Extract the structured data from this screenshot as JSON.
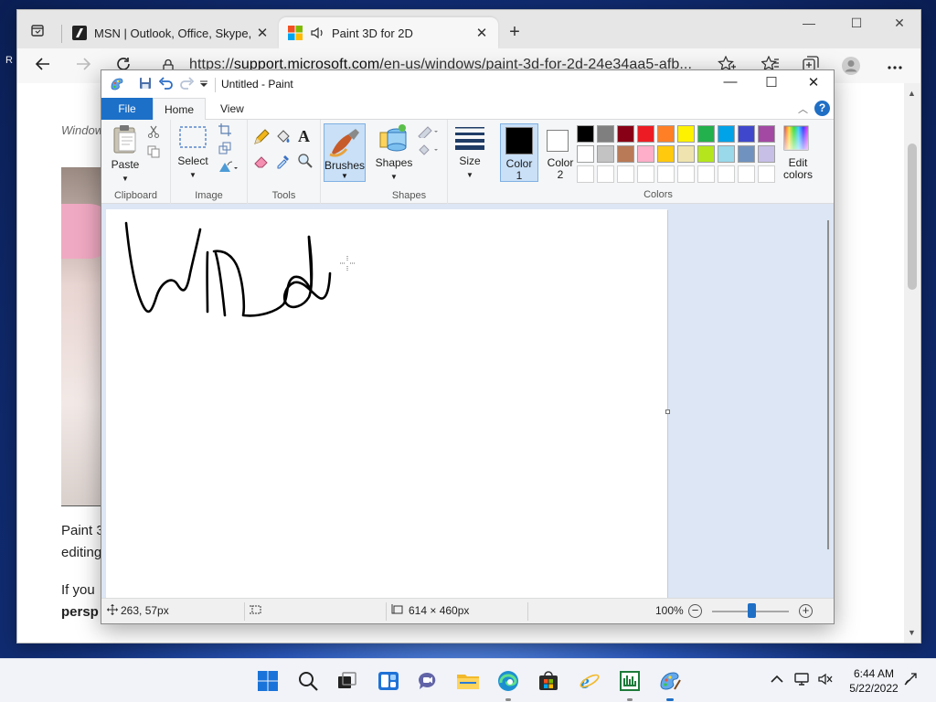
{
  "desktop": {
    "left_fragment": "R"
  },
  "browser": {
    "tabs": [
      {
        "title": "MSN | Outlook, Office, Skype, Bi",
        "close": "✕",
        "icon": "msn-icon"
      },
      {
        "title": "Paint 3D for 2D",
        "close": "✕",
        "icon": "microsoft-logo-icon",
        "audio_icon": "speaker-icon"
      }
    ],
    "new_tab": "+",
    "window_controls": {
      "minimize": "—",
      "maximize": "☐",
      "close": "✕"
    },
    "address": {
      "scheme": "https://",
      "host": "support.microsoft.com",
      "path": "/en-us/windows/paint-3d-for-2d-24e34aa5-afb..."
    },
    "page": {
      "crumb": "Window",
      "para1_line1": "Paint 3",
      "para1_line2": "editing",
      "para2_line1": "If you",
      "para2_line2_bold": "persp"
    }
  },
  "paint": {
    "window_title": "Untitled - Paint",
    "controls": {
      "minimize": "—",
      "maximize": "☐",
      "close": "✕"
    },
    "tabs": {
      "file": "File",
      "home": "Home",
      "view": "View"
    },
    "ribbon": {
      "clipboard": {
        "paste": "Paste",
        "label": "Clipboard"
      },
      "image": {
        "select": "Select",
        "label": "Image"
      },
      "tools": {
        "label": "Tools"
      },
      "brushes": {
        "label": "Brushes"
      },
      "shapes": {
        "shapes": "Shapes",
        "label": "Shapes"
      },
      "size": {
        "label": "Size"
      },
      "colors": {
        "color1": "Color",
        "color1_num": "1",
        "color2": "Color",
        "color2_num": "2",
        "edit": "Edit",
        "edit2": "colors",
        "label": "Colors",
        "color1_value": "#000000",
        "color2_value": "#ffffff",
        "palette_row1": [
          "#000000",
          "#7f7f7f",
          "#880015",
          "#ed1c24",
          "#ff7f27",
          "#fff200",
          "#22b14c",
          "#00a2e8",
          "#3f48cc",
          "#a349a4"
        ],
        "palette_row2": [
          "#ffffff",
          "#c3c3c3",
          "#b97a57",
          "#ffaec9",
          "#ffc90e",
          "#efe4b0",
          "#b5e61d",
          "#99d9ea",
          "#7092be",
          "#c8bfe7"
        ],
        "palette_row3": [
          "#ffffff",
          "#ffffff",
          "#ffffff",
          "#ffffff",
          "#ffffff",
          "#ffffff",
          "#ffffff",
          "#ffffff",
          "#ffffff",
          "#ffffff"
        ]
      }
    },
    "status": {
      "cursor_pos": "263, 57px",
      "canvas_size": "614 × 460px",
      "zoom": "100%",
      "zoom_level_percent": 100
    }
  },
  "taskbar": {
    "apps": [
      "windows-start-icon",
      "search-icon",
      "task-view-icon",
      "widgets-icon",
      "teams-chat-icon",
      "file-explorer-icon",
      "edge-icon",
      "store-icon",
      "internet-explorer-icon",
      "task-manager-icon",
      "paint-icon"
    ],
    "time": "6:44 AM",
    "date": "5/22/2022"
  }
}
